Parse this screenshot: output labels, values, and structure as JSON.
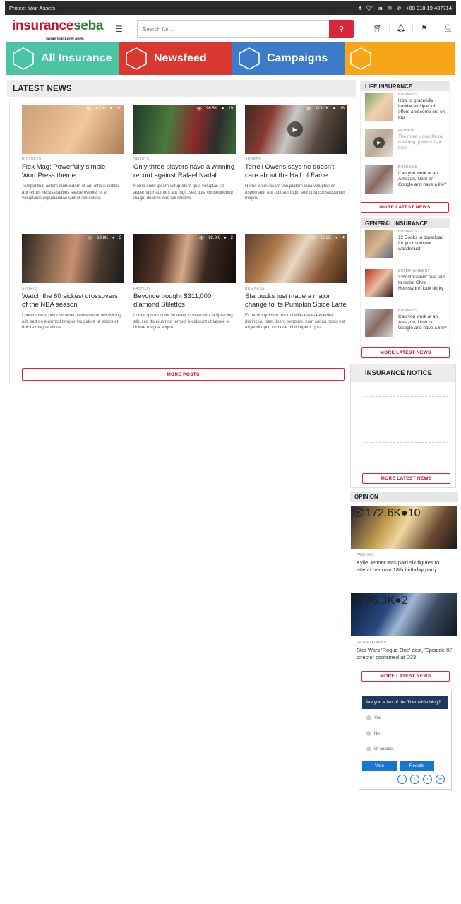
{
  "topbar": {
    "tagline": "Protect Your Assets",
    "phone": "+88 018 19 437714"
  },
  "header": {
    "logo_part1": "insurance",
    "logo_part2": "seba",
    "logo_tagline": "Secure Your Life & Assets",
    "search_placeholder": "Search for..."
  },
  "nav": [
    {
      "label": "All Insurance",
      "color": "#4cc3a2"
    },
    {
      "label": "Newsfeed",
      "color": "#d9372f"
    },
    {
      "label": "Campaigns",
      "color": "#3b7bc8"
    },
    {
      "label": "",
      "color": "#f7a617"
    }
  ],
  "latest": {
    "heading": "LATEST NEWS",
    "posts": [
      {
        "views": "422K",
        "comments": "20",
        "category": "BUSINESS",
        "title": "Flex Mag: Powerfully simple WordPress theme",
        "excerpt": "Temporibus autem quibusdam et aut officiis debitis aut rerum necessitatibus saepe eveniet ut et voluptates repudiandae sint et molestiae."
      },
      {
        "views": "96.5K",
        "comments": "19",
        "category": "SPORTS",
        "title": "Only three players have a winning record against Rafael Nadal",
        "excerpt": "Nemo enim ipsam voluptatem quia voluptas sit aspernatur aut odit aut fugit, sed quia consequuntur magni dolores eos qui ratione."
      },
      {
        "views": "113.1K",
        "comments": "18",
        "category": "SPORTS",
        "title": "Terrell Owens says he doesn't care about the Hall of Fame",
        "excerpt": "Nemo enim ipsam voluptatem quia voluptas sit aspernatur aut odit aut fugit, sed quia consequuntur magni."
      },
      {
        "views": "19.8K",
        "comments": "3",
        "category": "SPORTS",
        "title": "Watch the 60 sickest crossovers of the NBA season",
        "excerpt": "Lorem ipsum dolor sit amet, consectetur adipisicing elit, sed do eiusmod tempor incididunt ut labore et dolore magna aliqua."
      },
      {
        "views": "62.8K",
        "comments": "2",
        "category": "FASHION",
        "title": "Beyonce bought $311,000 diamond Stilettos",
        "excerpt": "Lorem ipsum dolor sit amet, consectetur adipisicing elit, sed do eiusmod tempor incididunt ut labore et dolore magna aliqua."
      },
      {
        "views": "52.2K",
        "comments": "4",
        "category": "BUSINESS",
        "title": "Starbucks just made a major change to its Pumpkin Spice Latte",
        "excerpt": "Et harum quidem rerum facilis est et expedita distinctio. Nam libero tempore, cum soluta nobis est eligendi optio cumque nihil impedit quo."
      }
    ],
    "more_label": "MORE POSTS"
  },
  "life": {
    "heading": "LIFE INSURANCE",
    "items": [
      {
        "category": "BUSINESS",
        "title": "How to gracefully handle multiple job offers and come out on top"
      },
      {
        "category": "FASHION",
        "title": "The most iconic Royal wedding gowns of all time"
      },
      {
        "category": "BUSINESS",
        "title": "Can you work at an Amazon, Uber or Google and have a life?"
      }
    ],
    "more_label": "MORE LATEST NEWS"
  },
  "general": {
    "heading": "GENERAL INSURANCE",
    "items": [
      {
        "category": "BUSINESS",
        "title": "12 Books to download for your summer wanderlust"
      },
      {
        "category": "ENTERTAINMENT",
        "title": "'Ghostbusters' reel fails to make Chris Hemsworth look dorky"
      },
      {
        "category": "BUSINESS",
        "title": "Can you work at an Amazon, Uber or Google and have a life?"
      }
    ],
    "more_label": "MORE LATEST NEWS"
  },
  "notice": {
    "heading": "INSURANCE NOTICE",
    "more_label": "MORE LATEST NEWS"
  },
  "opinion": {
    "heading": "OPINION",
    "items": [
      {
        "views": "172.6K",
        "comments": "10",
        "category": "FASHION",
        "title": "Kylie Jenner was paid six figures to attend her own 18th birthday party"
      },
      {
        "views": "96.3K",
        "comments": "2",
        "category": "ENTERTAINMENT",
        "title": "Star Wars 'Rogue One' cast, 'Episode IX' director confirmed at D23"
      }
    ],
    "more_label": "MORE LATEST NEWS"
  },
  "poll": {
    "question": "Are you a fan of the Themelsle blog?",
    "options": [
      "Yes",
      "No",
      "Of course!"
    ],
    "vote_label": "Vote",
    "results_label": "Results"
  }
}
